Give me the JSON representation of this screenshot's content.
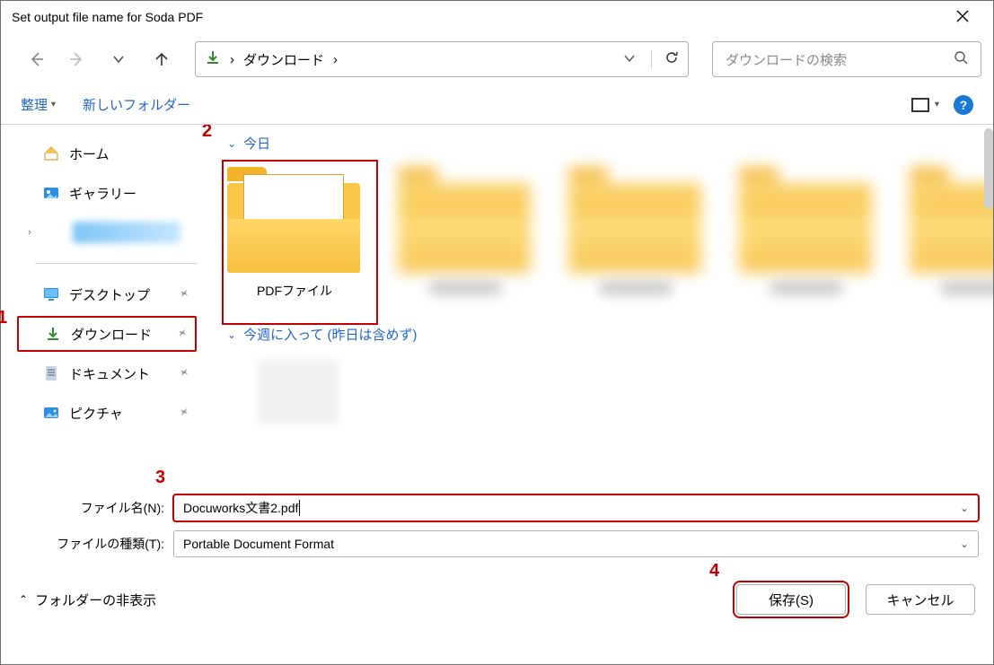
{
  "title": "Set output file name for Soda PDF",
  "breadcrumb": {
    "current": "ダウンロード",
    "sep1": "›",
    "sep2": "›"
  },
  "search": {
    "placeholder": "ダウンロードの検索"
  },
  "toolbar": {
    "organize": "整理",
    "newfolder": "新しいフォルダー"
  },
  "sidebar": {
    "home": "ホーム",
    "gallery": "ギャラリー",
    "desktop": "デスクトップ",
    "downloads": "ダウンロード",
    "documents": "ドキュメント",
    "pictures": "ピクチャ"
  },
  "groups": {
    "today": "今日",
    "thisweek": "今週に入って (昨日は含めず)"
  },
  "items": {
    "pdf_folder": "PDFファイル"
  },
  "labels": {
    "filename": "ファイル名(N):",
    "filetype": "ファイルの種類(T):"
  },
  "filename_value": "Docuworks文書2.pdf",
  "filetype_value": "Portable Document Format",
  "footer": {
    "collapse": "フォルダーの非表示",
    "save": "保存(S)",
    "cancel": "キャンセル"
  },
  "annotations": {
    "a1": "1",
    "a2": "2",
    "a3": "3",
    "a4": "4"
  }
}
